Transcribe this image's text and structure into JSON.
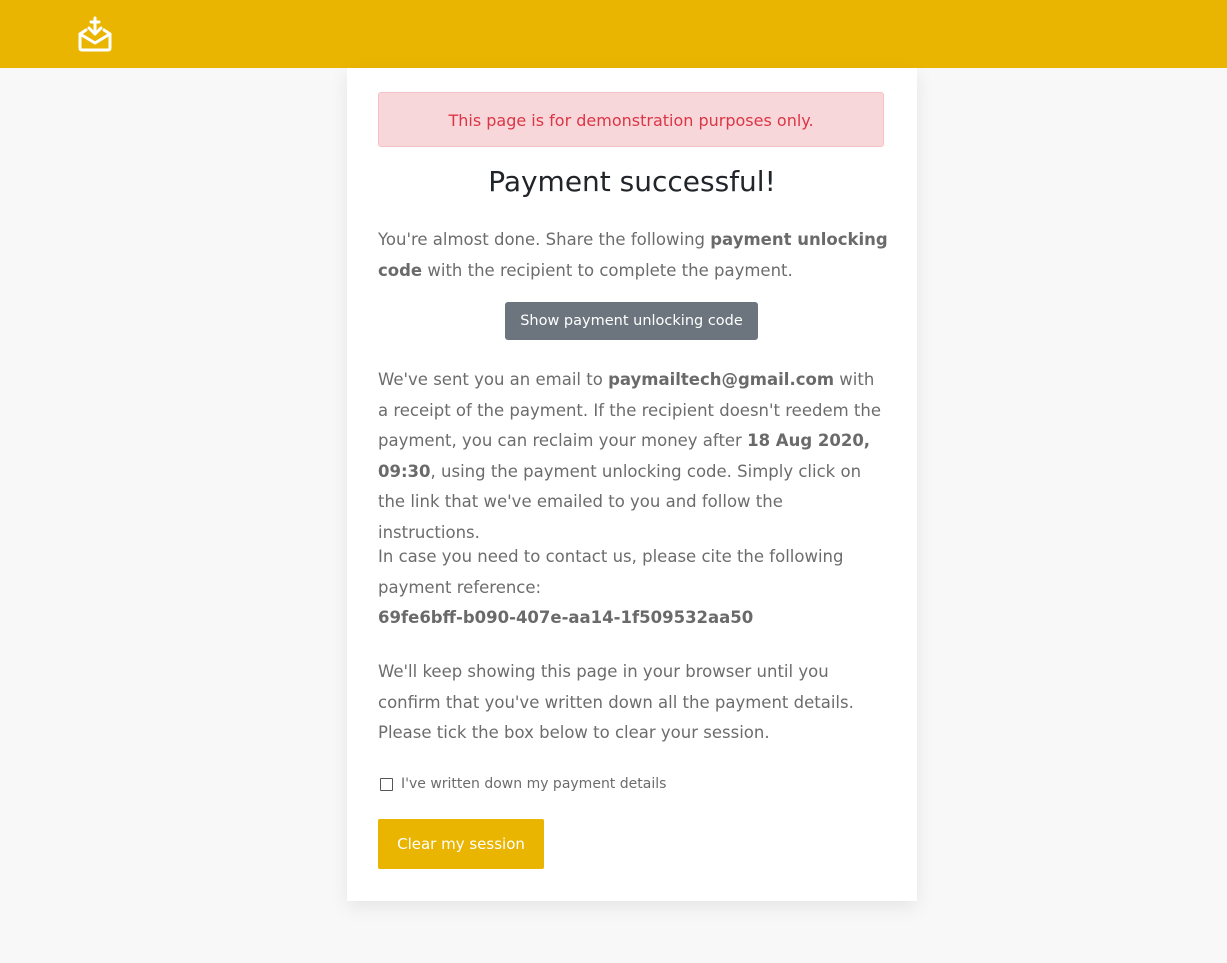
{
  "header": {
    "logo_icon": "mail-download-logo-icon",
    "bar_color": "#eab500"
  },
  "alert": {
    "text": "This page is for demonstration purposes only."
  },
  "title": "Payment successful!",
  "intro": {
    "before": "You're almost done. Share the following ",
    "bold": "payment unlocking code",
    "after": " with the recipient to complete the payment."
  },
  "show_code_button": "Show payment unlocking code",
  "email_notice": {
    "t1": "We've sent you an email to ",
    "email": "paymailtech@gmail.com",
    "t2": " with a receipt of the payment. If the recipient doesn't reedem the payment, you can reclaim your money after ",
    "date": "18 Aug 2020, 09:30",
    "t3": ", using the payment unlocking code. Simply click on the link that we've emailed to you and follow the instructions."
  },
  "reference": {
    "text": "In case you need to contact us, please cite the following payment reference:",
    "id": "69fe6bff-b090-407e-aa14-1f509532aa50"
  },
  "session_notice": "We'll keep showing this page in your browser until you confirm that you've written down all the payment details. Please tick the box below to clear your session.",
  "checkbox_label": "I've written down my payment details",
  "checkbox_checked": false,
  "clear_button": "Clear my session",
  "colors": {
    "accent": "#eab500",
    "alert_bg": "#f8d7da",
    "alert_text": "#dc3545",
    "secondary_button": "#6c757d"
  }
}
